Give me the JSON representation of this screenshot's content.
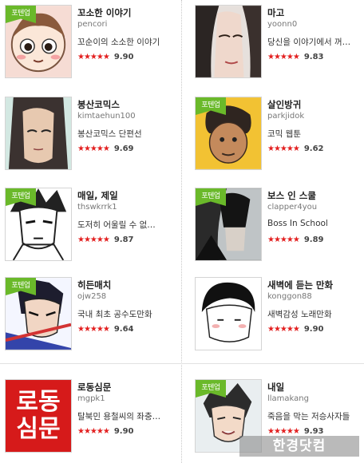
{
  "badge_label": "포텐업",
  "items": [
    {
      "title": "꼬소한 이야기",
      "author": "pencori",
      "desc": "꼬순이의 소소한 이야기",
      "stars": "★★★★★",
      "score": "9.90"
    },
    {
      "title": "마고",
      "author": "yoonn0",
      "desc": "당신을 이야기에서 꺼…",
      "stars": "★★★★★",
      "score": "9.83"
    },
    {
      "title": "봉산코믹스",
      "author": "kimtaehun100",
      "desc": "봉산코믹스 단편선",
      "stars": "★★★★★",
      "score": "9.69"
    },
    {
      "title": "살인방귀",
      "author": "parkjidok",
      "desc": "코믹 웹툰",
      "stars": "★★★★★",
      "score": "9.62"
    },
    {
      "title": "매일, 제일",
      "author": "thswkrrk1",
      "desc": "도저히 어울릴 수 없…",
      "stars": "★★★★★",
      "score": "9.87"
    },
    {
      "title": "보스 인 스쿨",
      "author": "clapper4you",
      "desc": "Boss In School",
      "stars": "★★★★★",
      "score": "9.89"
    },
    {
      "title": "히든매치",
      "author": "ojw258",
      "desc": "국내 최초 공수도만화",
      "stars": "★★★★★",
      "score": "9.64"
    },
    {
      "title": "새벽에 듣는 만화",
      "author": "konggon88",
      "desc": "새벽감성 노래만화",
      "stars": "★★★★★",
      "score": "9.90"
    },
    {
      "title": "로동심문",
      "author": "mgpk1",
      "desc": "탈북민 용철씨의 좌충…",
      "stars": "★★★★★",
      "score": "9.90"
    },
    {
      "title": "내일",
      "author": "llamakang",
      "desc": "죽음을 막는 저승사자들",
      "stars": "★★★★★",
      "score": "9.93"
    }
  ],
  "thumb_text_logo": "로동심문",
  "watermark": "한경닷컴",
  "colors": {
    "badge": "#6ab92a",
    "star": "#e32020"
  }
}
